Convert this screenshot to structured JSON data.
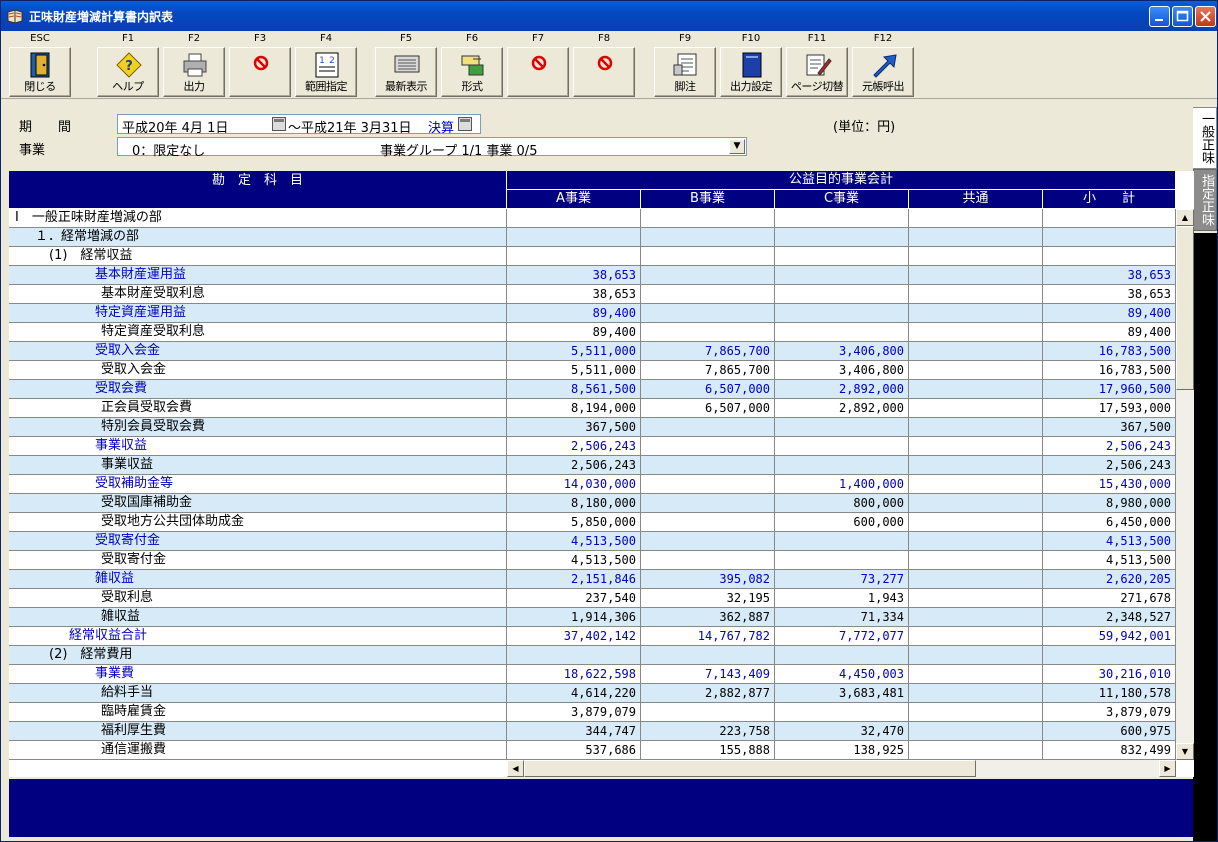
{
  "window": {
    "title": "正味財産増減計算書内訳表"
  },
  "toolbar": {
    "keys": [
      {
        "key": "ESC",
        "label": "閉じる",
        "icon": "door-exit-icon"
      },
      {
        "key": "F1",
        "label": "ヘルプ",
        "icon": "help-icon"
      },
      {
        "key": "F2",
        "label": "出力",
        "icon": "printer-icon"
      },
      {
        "key": "F3",
        "label": "",
        "icon": "disabled-icon"
      },
      {
        "key": "F4",
        "label": "範囲指定",
        "icon": "range-icon"
      },
      {
        "key": "F5",
        "label": "最新表示",
        "icon": "refresh-icon"
      },
      {
        "key": "F6",
        "label": "形式",
        "icon": "format-icon"
      },
      {
        "key": "F7",
        "label": "",
        "icon": "disabled-icon"
      },
      {
        "key": "F8",
        "label": "",
        "icon": "disabled-icon"
      },
      {
        "key": "F9",
        "label": "脚注",
        "icon": "footnote-icon"
      },
      {
        "key": "F10",
        "label": "出力設定",
        "icon": "output-settings-icon"
      },
      {
        "key": "F11",
        "label": "ページ切替",
        "icon": "page-switch-icon"
      },
      {
        "key": "F12",
        "label": "元帳呼出",
        "icon": "ledger-icon"
      }
    ]
  },
  "filters": {
    "period_label": "期　　間",
    "date_from": "平成20年 4月 1日",
    "date_to": "～平成21年 3月31日",
    "settlement": "決算",
    "unit": "(単位：円)",
    "business_label": "事業",
    "business_value": "0：限定なし",
    "business_group": "事業グループ 1/1 事業 0/5"
  },
  "side_tabs": {
    "active": "一般正味",
    "inactive": "指定正味"
  },
  "table": {
    "header_account": "勘　定　科　目",
    "header_group": "公益目的事業会計",
    "columns": [
      "A事業",
      "B事業",
      "C事業",
      "共通",
      "小　　計"
    ],
    "rows": [
      {
        "indent": 0,
        "blue": false,
        "label": "Ⅰ　一般正味財産増減の部",
        "v": [
          "",
          "",
          "",
          "",
          ""
        ]
      },
      {
        "indent": 1,
        "blue": false,
        "label": "１．経常増減の部",
        "v": [
          "",
          "",
          "",
          "",
          ""
        ]
      },
      {
        "indent": 2,
        "blue": false,
        "label": "(1)　経常収益",
        "v": [
          "",
          "",
          "",
          "",
          ""
        ]
      },
      {
        "indent": 3,
        "blue": true,
        "label": "基本財産運用益",
        "v": [
          "38,653",
          "",
          "",
          "",
          "38,653"
        ]
      },
      {
        "indent": 4,
        "blue": false,
        "label": "基本財産受取利息",
        "v": [
          "38,653",
          "",
          "",
          "",
          "38,653"
        ]
      },
      {
        "indent": 3,
        "blue": true,
        "label": "特定資産運用益",
        "v": [
          "89,400",
          "",
          "",
          "",
          "89,400"
        ]
      },
      {
        "indent": 4,
        "blue": false,
        "label": "特定資産受取利息",
        "v": [
          "89,400",
          "",
          "",
          "",
          "89,400"
        ]
      },
      {
        "indent": 3,
        "blue": true,
        "label": "受取入会金",
        "v": [
          "5,511,000",
          "7,865,700",
          "3,406,800",
          "",
          "16,783,500"
        ]
      },
      {
        "indent": 4,
        "blue": false,
        "label": "受取入会金",
        "v": [
          "5,511,000",
          "7,865,700",
          "3,406,800",
          "",
          "16,783,500"
        ]
      },
      {
        "indent": 3,
        "blue": true,
        "label": "受取会費",
        "v": [
          "8,561,500",
          "6,507,000",
          "2,892,000",
          "",
          "17,960,500"
        ]
      },
      {
        "indent": 4,
        "blue": false,
        "label": "正会員受取会費",
        "v": [
          "8,194,000",
          "6,507,000",
          "2,892,000",
          "",
          "17,593,000"
        ]
      },
      {
        "indent": 4,
        "blue": false,
        "label": "特別会員受取会費",
        "v": [
          "367,500",
          "",
          "",
          "",
          "367,500"
        ]
      },
      {
        "indent": 3,
        "blue": true,
        "label": "事業収益",
        "v": [
          "2,506,243",
          "",
          "",
          "",
          "2,506,243"
        ]
      },
      {
        "indent": 4,
        "blue": false,
        "label": "事業収益",
        "v": [
          "2,506,243",
          "",
          "",
          "",
          "2,506,243"
        ]
      },
      {
        "indent": 3,
        "blue": true,
        "label": "受取補助金等",
        "v": [
          "14,030,000",
          "",
          "1,400,000",
          "",
          "15,430,000"
        ]
      },
      {
        "indent": 4,
        "blue": false,
        "label": "受取国庫補助金",
        "v": [
          "8,180,000",
          "",
          "800,000",
          "",
          "8,980,000"
        ]
      },
      {
        "indent": 4,
        "blue": false,
        "label": "受取地方公共団体助成金",
        "v": [
          "5,850,000",
          "",
          "600,000",
          "",
          "6,450,000"
        ]
      },
      {
        "indent": 3,
        "blue": true,
        "label": "受取寄付金",
        "v": [
          "4,513,500",
          "",
          "",
          "",
          "4,513,500"
        ]
      },
      {
        "indent": 4,
        "blue": false,
        "label": "受取寄付金",
        "v": [
          "4,513,500",
          "",
          "",
          "",
          "4,513,500"
        ]
      },
      {
        "indent": 3,
        "blue": true,
        "label": "雑収益",
        "v": [
          "2,151,846",
          "395,082",
          "73,277",
          "",
          "2,620,205"
        ]
      },
      {
        "indent": 4,
        "blue": false,
        "label": "受取利息",
        "v": [
          "237,540",
          "32,195",
          "1,943",
          "",
          "271,678"
        ]
      },
      {
        "indent": 4,
        "blue": false,
        "label": "雑収益",
        "v": [
          "1,914,306",
          "362,887",
          "71,334",
          "",
          "2,348,527"
        ]
      },
      {
        "indent": 5,
        "blue": true,
        "label": "経常収益合計",
        "v": [
          "37,402,142",
          "14,767,782",
          "7,772,077",
          "",
          "59,942,001"
        ]
      },
      {
        "indent": 2,
        "blue": false,
        "label": "(2)　経常費用",
        "v": [
          "",
          "",
          "",
          "",
          ""
        ]
      },
      {
        "indent": 3,
        "blue": true,
        "label": "事業費",
        "v": [
          "18,622,598",
          "7,143,409",
          "4,450,003",
          "",
          "30,216,010"
        ]
      },
      {
        "indent": 4,
        "blue": false,
        "label": "給料手当",
        "v": [
          "4,614,220",
          "2,882,877",
          "3,683,481",
          "",
          "11,180,578"
        ]
      },
      {
        "indent": 4,
        "blue": false,
        "label": "臨時雇賃金",
        "v": [
          "3,879,079",
          "",
          "",
          "",
          "3,879,079"
        ]
      },
      {
        "indent": 4,
        "blue": false,
        "label": "福利厚生費",
        "v": [
          "344,747",
          "223,758",
          "32,470",
          "",
          "600,975"
        ]
      },
      {
        "indent": 4,
        "blue": false,
        "label": "通信運搬費",
        "v": [
          "537,686",
          "155,888",
          "138,925",
          "",
          "832,499"
        ]
      }
    ]
  }
}
